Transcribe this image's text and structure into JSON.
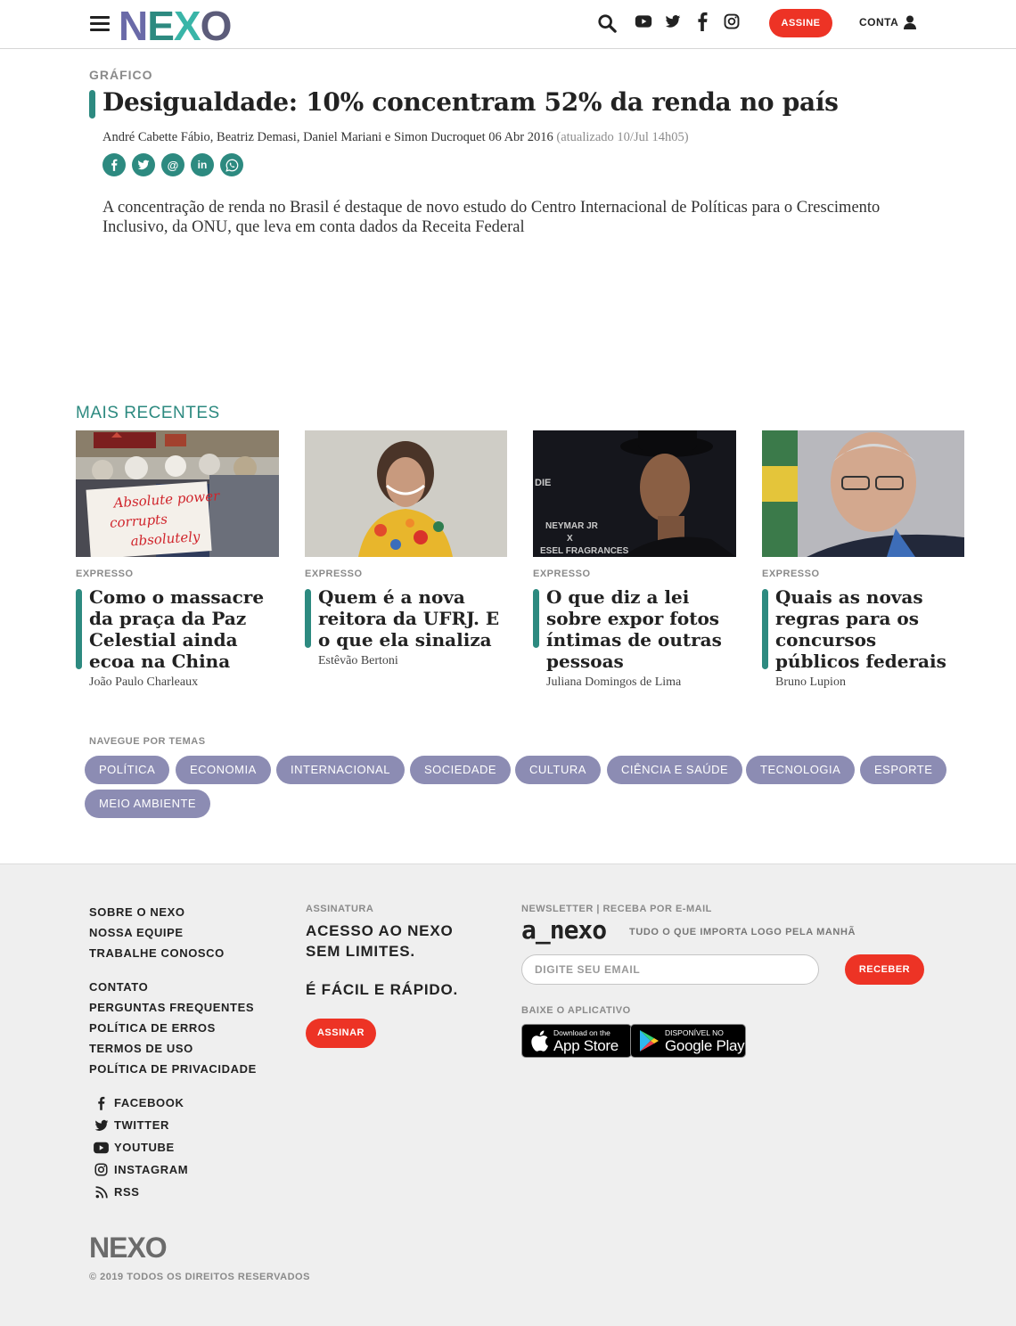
{
  "header": {
    "logo_text": "NEXO",
    "subscribe_label": "ASSINE",
    "account_label": "CONTA",
    "icons": [
      "menu-icon",
      "search-icon",
      "youtube-icon",
      "twitter-icon",
      "facebook-icon",
      "instagram-icon",
      "user-icon"
    ]
  },
  "article": {
    "kicker": "GRÁFICO",
    "title": "Desigualdade: 10% concentram 52% da renda no país",
    "byline": "André Cabette Fábio, Beatriz Demasi, Daniel Mariani e Simon Ducroquet 06 Abr 2016",
    "updated": "(atualizado 10/Jul 14h05)",
    "share_icons": [
      "facebook-icon",
      "twitter-icon",
      "email-icon",
      "linkedin-icon",
      "whatsapp-icon"
    ],
    "lede": "A concentração de renda no Brasil é destaque de novo estudo do Centro Internacional de Políticas para o Crescimento Inclusivo, da ONU, que leva em conta dados da Receita Federal"
  },
  "recent": {
    "section_title": "MAIS RECENTES",
    "cards": [
      {
        "kicker": "EXPRESSO",
        "title": "Como o massacre da praça da Paz Celestial ainda ecoa na China",
        "author": "João Paulo Charleaux",
        "image_text": [
          "Absolute power",
          "corrupts",
          "absolutely"
        ]
      },
      {
        "kicker": "EXPRESSO",
        "title": "Quem é a nova reitora da UFRJ. E o que ela sinaliza",
        "author": "Estêvão Bertoni"
      },
      {
        "kicker": "EXPRESSO",
        "title": "O que diz a lei sobre expor fotos íntimas de outras pessoas",
        "author": "Juliana Domingos de Lima",
        "image_text": [
          "NEYMAR JR",
          "X",
          "ESEL FRAGRANCES",
          "DIE"
        ]
      },
      {
        "kicker": "EXPRESSO",
        "title": "Quais as novas regras para os concursos públicos federais",
        "author": "Bruno Lupion"
      }
    ]
  },
  "topics": {
    "label": "NAVEGUE POR TEMAS",
    "items": [
      "POLÍTICA",
      "ECONOMIA",
      "INTERNACIONAL",
      "SOCIEDADE",
      "CULTURA",
      "CIÊNCIA E SAÚDE",
      "TECNOLOGIA",
      "ESPORTE",
      "MEIO AMBIENTE"
    ]
  },
  "footer": {
    "links_group1": [
      "SOBRE O NEXO",
      "NOSSA EQUIPE",
      "TRABALHE CONOSCO"
    ],
    "links_group2": [
      "CONTATO",
      "PERGUNTAS FREQUENTES",
      "POLÍTICA DE ERROS",
      "TERMOS DE USO",
      "POLÍTICA DE PRIVACIDADE"
    ],
    "social": [
      "FACEBOOK",
      "TWITTER",
      "YOUTUBE",
      "INSTAGRAM",
      "RSS"
    ],
    "subscription_label": "ASSINATURA",
    "subscription_line1": "ACESSO AO NEXO",
    "subscription_line2": "SEM LIMITES.",
    "subscription_line3": "É FÁCIL E RÁPIDO.",
    "subscribe_button": "ASSINAR",
    "newsletter_label": "NEWSLETTER | RECEBA POR E-MAIL",
    "newsletter_logo": "a_nexo",
    "newsletter_tagline": "TUDO O QUE IMPORTA LOGO PELA MANHÃ",
    "email_placeholder": "DIGITE SEU EMAIL",
    "receive_button": "RECEBER",
    "app_label": "BAIXE O APLICATIVO",
    "appstore_small": "Download on the",
    "appstore_big": "App Store",
    "googleplay_small": "DISPONÍVEL NO",
    "googleplay_big": "Google Play",
    "logo_text": "NEXO",
    "copyright": "© 2019 TODOS OS DIREITOS RESERVADOS"
  },
  "colors": {
    "accent_teal": "#2d8a80",
    "brand_red": "#ed3325",
    "topic_pill": "#8c8cb3",
    "footer_bg": "#efefef"
  }
}
